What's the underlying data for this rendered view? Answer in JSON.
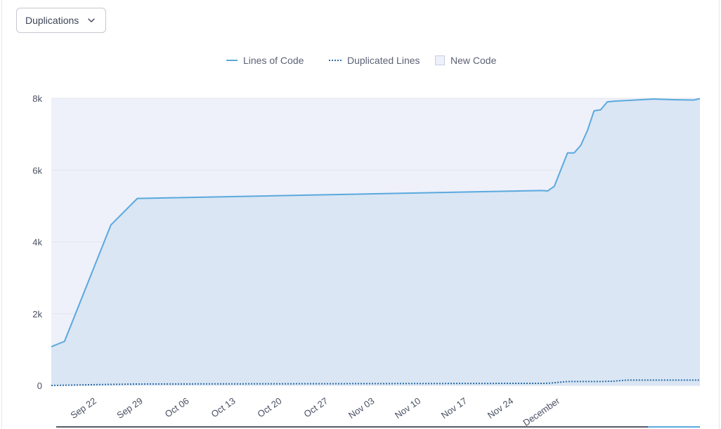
{
  "metric_select": {
    "label": "Duplications",
    "icon": "chevron-down-icon"
  },
  "chart_data": {
    "type": "line",
    "x_type": "date",
    "x_ticks": [
      "Sep 22",
      "Sep 29",
      "Oct 06",
      "Oct 13",
      "Oct 20",
      "Oct 27",
      "Nov 03",
      "Nov 10",
      "Nov 17",
      "Nov 24",
      "December"
    ],
    "y_ticks": [
      "8k",
      "6k",
      "4k",
      "2k",
      "0"
    ],
    "ylim": [
      0,
      8000
    ],
    "xlim": [
      "Sep 17",
      "Dec 24"
    ],
    "grid": "horizontal",
    "legend_position": "top",
    "legend": [
      "Lines of Code",
      "Duplicated Lines",
      "New Code"
    ],
    "colors": {
      "lines_of_code": "#5aa9dd",
      "duplicated_lines": "#2e6ea6",
      "new_code": "#eef0fa",
      "area": "#dae6f4"
    },
    "new_code_period": [
      "Sep 17",
      "Dec 24"
    ],
    "series": [
      {
        "name": "Lines of Code",
        "style": "solid",
        "x": [
          "Sep 17",
          "Sep 19",
          "Sep 26",
          "Sep 30",
          "Nov 30",
          "Dec 01",
          "Dec 02",
          "Dec 04",
          "Dec 05",
          "Dec 06",
          "Dec 07",
          "Dec 08",
          "Dec 09",
          "Dec 10",
          "Dec 11",
          "Dec 13",
          "Dec 17",
          "Dec 20",
          "Dec 23",
          "Dec 24"
        ],
        "values": [
          1080,
          1230,
          4470,
          5210,
          5430,
          5420,
          5550,
          6480,
          6480,
          6690,
          7100,
          7650,
          7680,
          7900,
          7920,
          7940,
          7980,
          7960,
          7950,
          7990
        ]
      },
      {
        "name": "Duplicated Lines",
        "style": "dotted",
        "x": [
          "Sep 17",
          "Sep 26",
          "Sep 30",
          "Dec 01",
          "Dec 04",
          "Dec 09",
          "Dec 11",
          "Dec 13",
          "Dec 24"
        ],
        "values": [
          0,
          30,
          40,
          60,
          110,
          110,
          120,
          150,
          150
        ]
      }
    ]
  }
}
